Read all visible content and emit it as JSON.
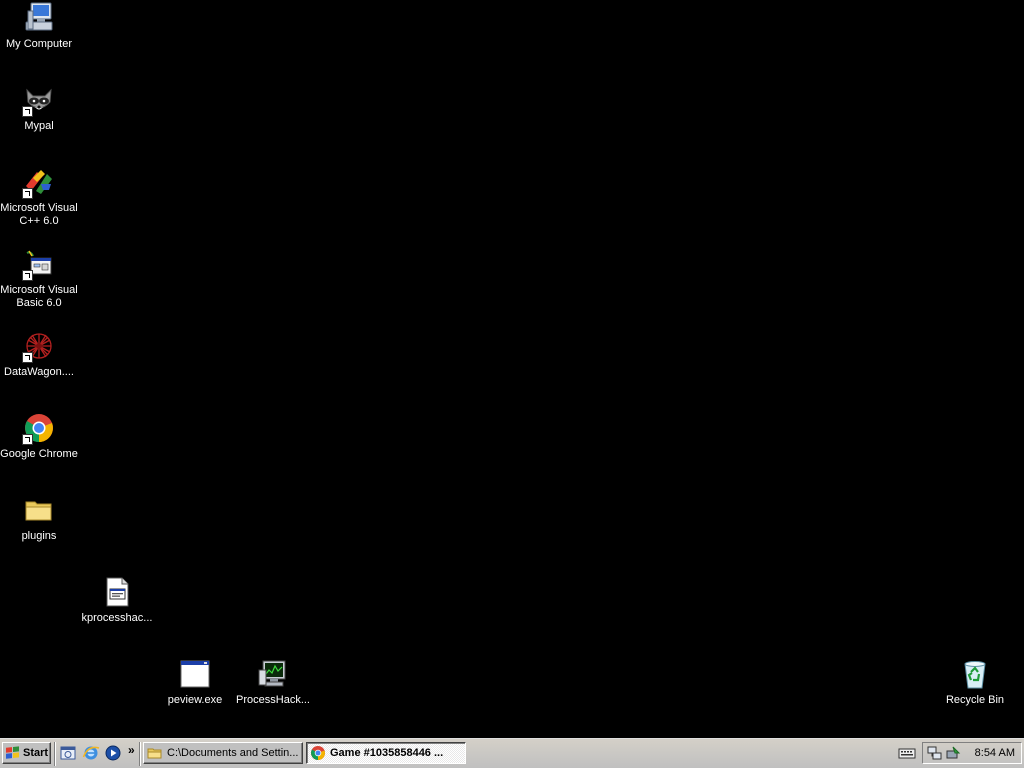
{
  "desktop": {
    "background_color": "#000000",
    "icons": [
      {
        "label": "My Computer",
        "icon": "my-computer-icon"
      },
      {
        "label": "Mypal",
        "icon": "mypal-raccoon-icon"
      },
      {
        "label": "Microsoft Visual\nC++ 6.0",
        "icon": "visual-cpp-icon"
      },
      {
        "label": "Microsoft Visual\nBasic 6.0",
        "icon": "visual-basic-icon"
      },
      {
        "label": "DataWagon....",
        "icon": "datawagon-icon"
      },
      {
        "label": "Google Chrome",
        "icon": "chrome-icon"
      },
      {
        "label": "plugins",
        "icon": "folder-icon"
      },
      {
        "label": "kprocesshac...",
        "icon": "system-file-icon"
      },
      {
        "label": "peview.exe",
        "icon": "exe-window-icon"
      },
      {
        "label": "ProcessHack...",
        "icon": "process-hacker-icon"
      },
      {
        "label": "Recycle Bin",
        "icon": "recycle-bin-icon"
      }
    ]
  },
  "taskbar": {
    "start_label": "Start",
    "quick_launch": [
      "show-desktop-icon",
      "internet-explorer-icon",
      "media-player-icon"
    ],
    "chevron": "»",
    "tasks": [
      {
        "label": "C:\\Documents and Settin...",
        "icon": "folder-icon",
        "active": false
      },
      {
        "label": "Game #1035858446 ...",
        "icon": "chrome-icon",
        "active": true
      }
    ],
    "keyboard_icon": "keyboard-icon",
    "tray_icons": [
      "network-icon",
      "safely-remove-icon"
    ],
    "clock": "8:54 AM"
  }
}
